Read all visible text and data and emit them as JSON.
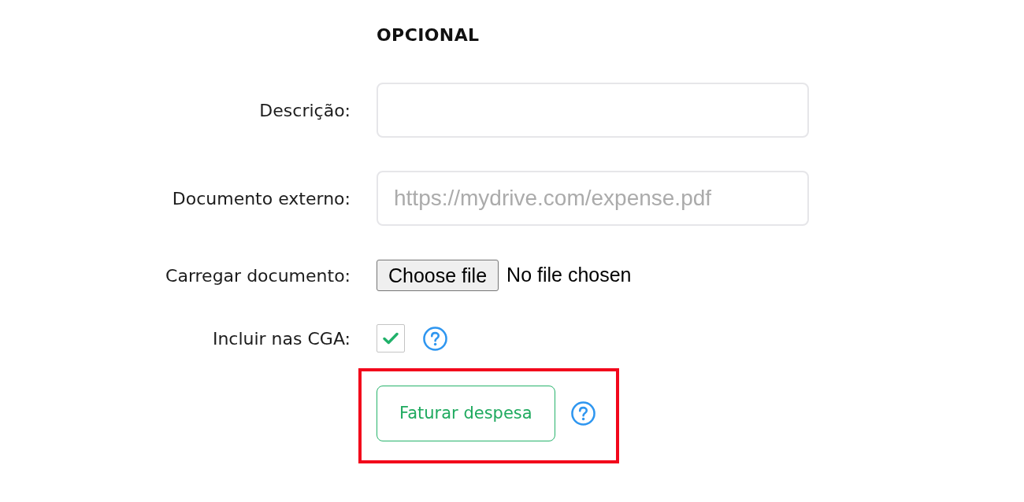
{
  "section": {
    "title": "OPCIONAL"
  },
  "fields": [
    {
      "kind": "text",
      "label": "Descrição:"
    },
    {
      "kind": "text",
      "label": "Documento externo:",
      "placeholder": "https://mydrive.com/expense.pdf"
    },
    {
      "kind": "file",
      "label": "Carregar documento:",
      "button": "Choose file",
      "status": "No file chosen"
    },
    {
      "kind": "checkbox",
      "label": "Incluir nas CGA:",
      "checked": true,
      "help": true
    }
  ],
  "action": {
    "label": "Faturar despesa",
    "help": true,
    "highlighted": true
  }
}
